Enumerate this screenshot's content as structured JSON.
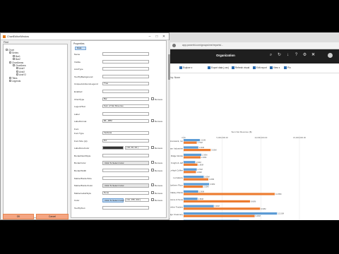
{
  "dialog": {
    "title": "ChartEditorWindow",
    "find_label": "Find",
    "tree": [
      {
        "label": "Chart",
        "depth": 0
      },
      {
        "label": "Series",
        "depth": 1
      },
      {
        "label": "Bar1",
        "depth": 2
      },
      {
        "label": "Bar2",
        "depth": 2
      },
      {
        "label": "ChartAreas",
        "depth": 1
      },
      {
        "label": "ChartArea",
        "depth": 2
      },
      {
        "label": "AxisY",
        "depth": 3
      },
      {
        "label": "AxisX",
        "depth": 3
      },
      {
        "label": "AxisY2",
        "depth": 3
      },
      {
        "label": "Titles",
        "depth": 1
      },
      {
        "label": "Legends",
        "depth": 1
      }
    ],
    "properties_title": "Properties",
    "properties_tab": "Data",
    "properties": [
      {
        "label": "Name",
        "value": "",
        "type": "field"
      },
      {
        "label": "Visible",
        "value": "",
        "type": "field"
      },
      {
        "label": "AxisType",
        "value": "",
        "type": "field"
      },
      {
        "label": "ToolTipBackground",
        "value": "",
        "type": "field"
      },
      {
        "label": "UniqueAxisItemsLegend",
        "value": "True",
        "type": "field"
      },
      {
        "label": "Enabled",
        "value": "",
        "type": "field"
      },
      {
        "label": "ChartType",
        "value": "Bar",
        "type": "field",
        "remove": true
      },
      {
        "label": "LegendText",
        "value": "Sum of Net Revenue",
        "type": "field"
      },
      {
        "label": "Label",
        "value": "",
        "type": "field"
      },
      {
        "label": "LabelFormat",
        "value": "$#,,,##M",
        "type": "field",
        "remove": true
      },
      {
        "label": "Font",
        "value": "",
        "type": "header"
      },
      {
        "label": "Font Type",
        "value": "Verdana",
        "type": "field"
      },
      {
        "label": "Font Size (pt)",
        "value": "8.0",
        "type": "field"
      },
      {
        "label": "LabelForeColor",
        "value": "",
        "type": "dark",
        "extra": "[ 00, 00, 00 ]",
        "remove": true
      },
      {
        "label": "BorderDashStyle",
        "value": "",
        "type": "field"
      },
      {
        "label": "BorderColor",
        "value": "Click To Select Color",
        "type": "button",
        "remove": true
      },
      {
        "label": "BorderWidth",
        "value": "",
        "type": "field",
        "remove": true
      },
      {
        "label": "MarkerBorderSize",
        "value": "",
        "type": "field"
      },
      {
        "label": "MarkerBorderColor",
        "value": "Click To Select Color",
        "type": "button",
        "remove": true
      },
      {
        "label": "MarkerLabelStyle",
        "value": "None",
        "type": "field",
        "remove": true
      },
      {
        "label": "Color",
        "value": "Click To Select Color",
        "type": "button-hl",
        "extra": "[ 91, 155, 213 ]",
        "remove": true
      },
      {
        "label": "ToolTipText",
        "value": "",
        "type": "field"
      }
    ],
    "remove_label": "Remove",
    "ok_label": "OK",
    "cancel_label": "Cancel"
  },
  "browser": {
    "url": "app.powerbi.com/groups/me/reports/...",
    "app_title": "Organization",
    "toolbar": [
      "Explore ▾",
      "Export data (.csv)",
      "Refresh visual",
      "Edit report",
      "View ▾",
      "Pin"
    ],
    "filter_text": "ing by: None"
  },
  "chart_data": {
    "type": "bar",
    "title": "",
    "top_axis_label": "Sum Net Revenue ($)",
    "bottom_axis_label": "Sum Net Revenue ($)",
    "categories": [
      "Brunswick, Inc",
      "Cobham Industries",
      "Global Ridge Works",
      "Knight & Jeff",
      "Lehigh Coffee",
      "La Galerie",
      "Northern Flour",
      "Oakley Paints",
      "Riverstone & Sons",
      "Shoreline Traders",
      "Stonebridge Creamery",
      "Westbrook Outfitters"
    ],
    "series": [
      {
        "name": "Sum Net Revenue ($)",
        "color": "#5b9bd5",
        "values": [
          2100000,
          1900000,
          2300000,
          1500000,
          1700000,
          2600000,
          3300000,
          1900000,
          1800000,
          3900000,
          12100000,
          7200000
        ]
      },
      {
        "name": "Sum Net Revenue ($) 2",
        "color": "#ed7d31",
        "values": [
          1700000,
          3500000,
          2200000,
          1800000,
          1600000,
          3200000,
          2500000,
          11800000,
          8600000,
          9900000,
          9200000,
          10800000
        ]
      }
    ],
    "xticks": [
      "0.00",
      "5,000,000.00",
      "10,000,000.00",
      "15,000,000.00"
    ],
    "xlim": [
      0,
      15000000
    ],
    "legend_position": "bottom"
  }
}
